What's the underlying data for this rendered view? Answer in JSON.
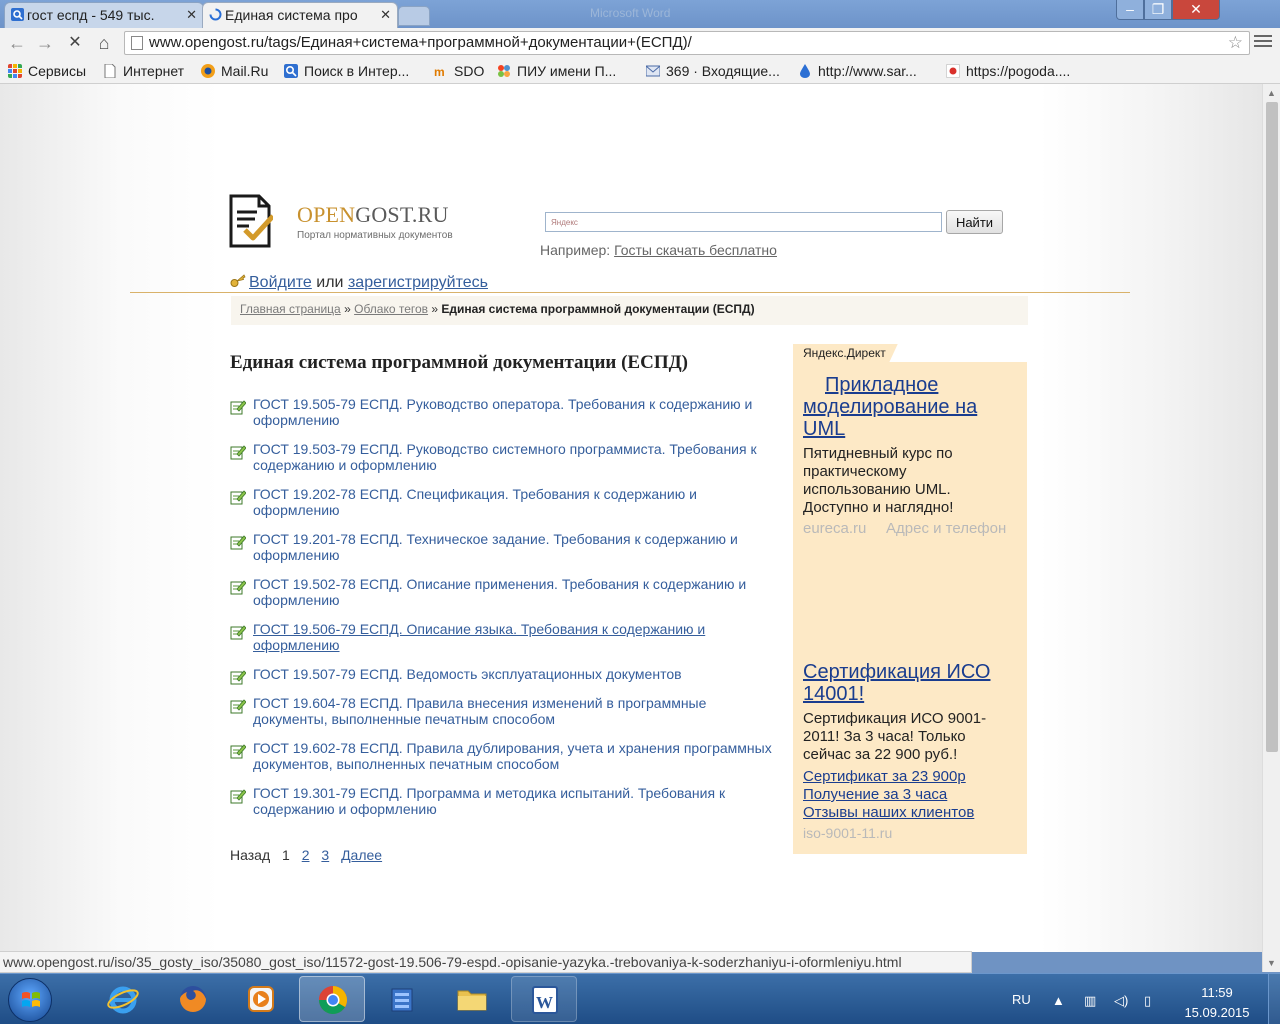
{
  "browser": {
    "tabs": [
      {
        "title": "гост еспд - 549 тыс.",
        "active": false
      },
      {
        "title": "Единая система про",
        "active": true
      }
    ],
    "window_title_ghost": "Microsoft Word",
    "url": "www.opengost.ru/tags/Единая+система+программной+документации+(ЕСПД)/",
    "bookmarks": [
      {
        "label": "Сервисы",
        "icon": "apps-grid-icon"
      },
      {
        "label": "Интернет",
        "icon": "page-icon"
      },
      {
        "label": "Mail.Ru",
        "icon": "mailru-icon"
      },
      {
        "label": "Поиск в Интер...",
        "icon": "search-icon"
      },
      {
        "label": "SDO",
        "icon": "moodle-icon"
      },
      {
        "label": "ПИУ имени П...",
        "icon": "joomla-icon"
      },
      {
        "label": "369 · Входящие...",
        "icon": "mail-icon"
      },
      {
        "label": "http://www.sar...",
        "icon": "drop-icon"
      },
      {
        "label": "https://pogoda....",
        "icon": "weather-icon"
      }
    ],
    "status_url": "www.opengost.ru/iso/35_gosty_iso/35080_gost_iso/11572-gost-19.506-79-espd.-opisanie-yazyka.-trebovaniya-k-soderzhaniyu-i-oformleniyu.html"
  },
  "site": {
    "logo_open": "OPEN",
    "logo_rest": "GOST.RU",
    "tagline": "Портал нормативных документов",
    "search_placeholder": "Яндекс",
    "search_button": "Найти",
    "example_prefix": "Например:",
    "example_link": "Госты скачать бесплатно",
    "login_link": "Войдите",
    "login_or": "или",
    "register_link": "зарегистрируйтесь",
    "breadcrumb": {
      "home": "Главная страница",
      "sep": "»",
      "tags": "Облако тегов",
      "current": "Единая система программной документации (ЕСПД)"
    },
    "heading": "Единая система программной документации (ЕСПД)",
    "documents": [
      "ГОСТ 19.505-79 ЕСПД. Руководство оператора. Требования к содержанию и оформлению",
      "ГОСТ 19.503-79 ЕСПД. Руководство системного программиста. Требования к содержанию и оформлению",
      "ГОСТ 19.202-78 ЕСПД. Спецификация. Требования к содержанию и оформлению",
      "ГОСТ 19.201-78 ЕСПД. Техническое задание. Требования к содержанию и оформлению",
      "ГОСТ 19.502-78 ЕСПД. Описание применения. Требования к содержанию и оформлению",
      "ГОСТ 19.506-79 ЕСПД. Описание языка. Требования к содержанию и оформлению",
      "ГОСТ 19.507-79 ЕСПД. Ведомость эксплуатационных документов",
      "ГОСТ 19.604-78 ЕСПД. Правила внесения изменений в программные документы, выполненные печатным способом",
      "ГОСТ 19.602-78 ЕСПД. Правила дублирования, учета и хранения программных документов, выполненных печатным способом",
      "ГОСТ 19.301-79 ЕСПД. Программа и методика испытаний. Требования к содержанию и оформлению"
    ],
    "pager": {
      "back": "Назад",
      "current": "1",
      "page2": "2",
      "page3": "3",
      "next": "Далее"
    }
  },
  "ad": {
    "label": "Яндекс.Директ",
    "ad1": {
      "title": "Прикладное моделирование на UML",
      "text": "Пятидневный курс по практическому использованию UML. Доступно и наглядно!",
      "domain": "eureca.ru",
      "contacts": "Адрес и телефон"
    },
    "ad2": {
      "title": "Сертификация ИСО 14001!",
      "text": "Сертификация ИСО 9001-2011! За 3 часа! Только сейчас за 22 900 руб.!",
      "links": [
        "Сертификат за 23 900р",
        "Получение за 3 часа",
        "Отзывы наших клиентов"
      ],
      "domain": "iso-9001-11.ru"
    }
  },
  "taskbar": {
    "lang": "RU",
    "time": "11:59",
    "date": "15.09.2015"
  },
  "colors": {
    "link": "#355e9c",
    "ad_link": "#1a3d8f",
    "ad_bg": "#fde9c6",
    "logo_gold": "#c8912e"
  }
}
